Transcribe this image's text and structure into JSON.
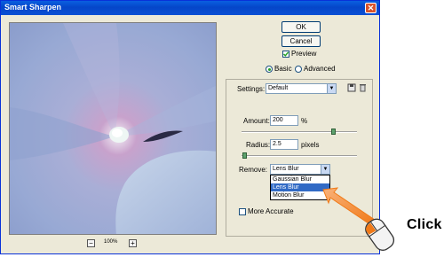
{
  "dialog": {
    "title": "Smart Sharpen",
    "close_glyph": "✕"
  },
  "buttons": {
    "ok_label": "OK",
    "cancel_label": "Cancel"
  },
  "preview_option": {
    "label": "Preview",
    "checked": true
  },
  "mode": {
    "basic_label": "Basic",
    "advanced_label": "Advanced",
    "selected": "Basic"
  },
  "settings": {
    "label": "Settings:",
    "value": "Default",
    "save_icon": "save-settings-icon",
    "delete_icon": "delete-settings-icon"
  },
  "amount": {
    "label": "Amount:",
    "value": "200",
    "unit": "%",
    "slider_fraction": 0.8
  },
  "radius": {
    "label": "Radius:",
    "value": "2.5",
    "unit": "pixels",
    "slider_fraction": 0.03
  },
  "remove": {
    "label": "Remove:",
    "value": "Lens Blur",
    "options": [
      "Gaussian Blur",
      "Lens Blur",
      "Motion Blur"
    ],
    "highlighted": "Lens Blur"
  },
  "more_accurate": {
    "label": "More Accurate",
    "checked": false
  },
  "zoom": {
    "minus": "−",
    "value": "100%",
    "plus": "+"
  },
  "callout": {
    "text": "Click",
    "arrow_color": "#f07a18",
    "icon": "mouse-click-icon"
  },
  "colors": {
    "titlebar": "#0a5fe0",
    "dialog_bg": "#ece9d8",
    "selection": "#316ac5",
    "slider_knob": "#5da26d"
  }
}
